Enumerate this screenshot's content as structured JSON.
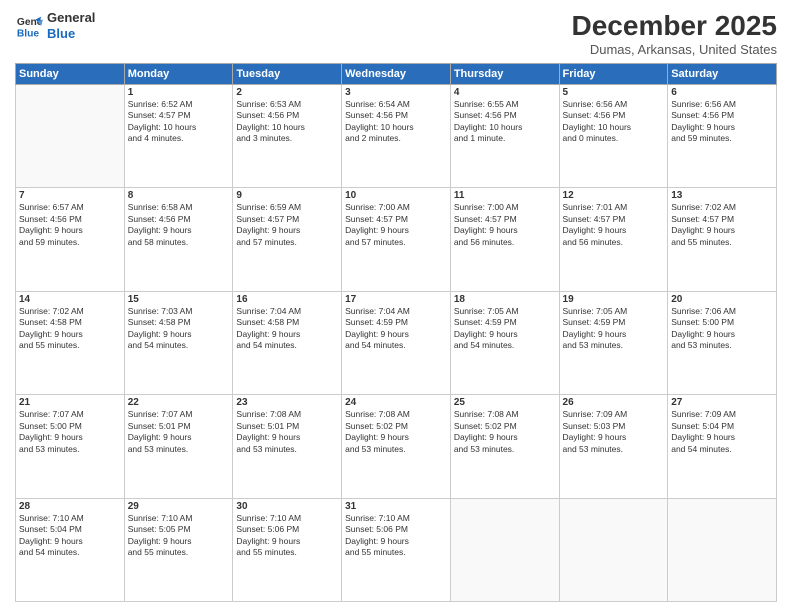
{
  "header": {
    "logo_line1": "General",
    "logo_line2": "Blue",
    "month_title": "December 2025",
    "location": "Dumas, Arkansas, United States"
  },
  "weekdays": [
    "Sunday",
    "Monday",
    "Tuesday",
    "Wednesday",
    "Thursday",
    "Friday",
    "Saturday"
  ],
  "weeks": [
    [
      {
        "day": "",
        "info": ""
      },
      {
        "day": "1",
        "info": "Sunrise: 6:52 AM\nSunset: 4:57 PM\nDaylight: 10 hours\nand 4 minutes."
      },
      {
        "day": "2",
        "info": "Sunrise: 6:53 AM\nSunset: 4:56 PM\nDaylight: 10 hours\nand 3 minutes."
      },
      {
        "day": "3",
        "info": "Sunrise: 6:54 AM\nSunset: 4:56 PM\nDaylight: 10 hours\nand 2 minutes."
      },
      {
        "day": "4",
        "info": "Sunrise: 6:55 AM\nSunset: 4:56 PM\nDaylight: 10 hours\nand 1 minute."
      },
      {
        "day": "5",
        "info": "Sunrise: 6:56 AM\nSunset: 4:56 PM\nDaylight: 10 hours\nand 0 minutes."
      },
      {
        "day": "6",
        "info": "Sunrise: 6:56 AM\nSunset: 4:56 PM\nDaylight: 9 hours\nand 59 minutes."
      }
    ],
    [
      {
        "day": "7",
        "info": "Sunrise: 6:57 AM\nSunset: 4:56 PM\nDaylight: 9 hours\nand 59 minutes."
      },
      {
        "day": "8",
        "info": "Sunrise: 6:58 AM\nSunset: 4:56 PM\nDaylight: 9 hours\nand 58 minutes."
      },
      {
        "day": "9",
        "info": "Sunrise: 6:59 AM\nSunset: 4:57 PM\nDaylight: 9 hours\nand 57 minutes."
      },
      {
        "day": "10",
        "info": "Sunrise: 7:00 AM\nSunset: 4:57 PM\nDaylight: 9 hours\nand 57 minutes."
      },
      {
        "day": "11",
        "info": "Sunrise: 7:00 AM\nSunset: 4:57 PM\nDaylight: 9 hours\nand 56 minutes."
      },
      {
        "day": "12",
        "info": "Sunrise: 7:01 AM\nSunset: 4:57 PM\nDaylight: 9 hours\nand 56 minutes."
      },
      {
        "day": "13",
        "info": "Sunrise: 7:02 AM\nSunset: 4:57 PM\nDaylight: 9 hours\nand 55 minutes."
      }
    ],
    [
      {
        "day": "14",
        "info": "Sunrise: 7:02 AM\nSunset: 4:58 PM\nDaylight: 9 hours\nand 55 minutes."
      },
      {
        "day": "15",
        "info": "Sunrise: 7:03 AM\nSunset: 4:58 PM\nDaylight: 9 hours\nand 54 minutes."
      },
      {
        "day": "16",
        "info": "Sunrise: 7:04 AM\nSunset: 4:58 PM\nDaylight: 9 hours\nand 54 minutes."
      },
      {
        "day": "17",
        "info": "Sunrise: 7:04 AM\nSunset: 4:59 PM\nDaylight: 9 hours\nand 54 minutes."
      },
      {
        "day": "18",
        "info": "Sunrise: 7:05 AM\nSunset: 4:59 PM\nDaylight: 9 hours\nand 54 minutes."
      },
      {
        "day": "19",
        "info": "Sunrise: 7:05 AM\nSunset: 4:59 PM\nDaylight: 9 hours\nand 53 minutes."
      },
      {
        "day": "20",
        "info": "Sunrise: 7:06 AM\nSunset: 5:00 PM\nDaylight: 9 hours\nand 53 minutes."
      }
    ],
    [
      {
        "day": "21",
        "info": "Sunrise: 7:07 AM\nSunset: 5:00 PM\nDaylight: 9 hours\nand 53 minutes."
      },
      {
        "day": "22",
        "info": "Sunrise: 7:07 AM\nSunset: 5:01 PM\nDaylight: 9 hours\nand 53 minutes."
      },
      {
        "day": "23",
        "info": "Sunrise: 7:08 AM\nSunset: 5:01 PM\nDaylight: 9 hours\nand 53 minutes."
      },
      {
        "day": "24",
        "info": "Sunrise: 7:08 AM\nSunset: 5:02 PM\nDaylight: 9 hours\nand 53 minutes."
      },
      {
        "day": "25",
        "info": "Sunrise: 7:08 AM\nSunset: 5:02 PM\nDaylight: 9 hours\nand 53 minutes."
      },
      {
        "day": "26",
        "info": "Sunrise: 7:09 AM\nSunset: 5:03 PM\nDaylight: 9 hours\nand 53 minutes."
      },
      {
        "day": "27",
        "info": "Sunrise: 7:09 AM\nSunset: 5:04 PM\nDaylight: 9 hours\nand 54 minutes."
      }
    ],
    [
      {
        "day": "28",
        "info": "Sunrise: 7:10 AM\nSunset: 5:04 PM\nDaylight: 9 hours\nand 54 minutes."
      },
      {
        "day": "29",
        "info": "Sunrise: 7:10 AM\nSunset: 5:05 PM\nDaylight: 9 hours\nand 55 minutes."
      },
      {
        "day": "30",
        "info": "Sunrise: 7:10 AM\nSunset: 5:06 PM\nDaylight: 9 hours\nand 55 minutes."
      },
      {
        "day": "31",
        "info": "Sunrise: 7:10 AM\nSunset: 5:06 PM\nDaylight: 9 hours\nand 55 minutes."
      },
      {
        "day": "",
        "info": ""
      },
      {
        "day": "",
        "info": ""
      },
      {
        "day": "",
        "info": ""
      }
    ]
  ]
}
